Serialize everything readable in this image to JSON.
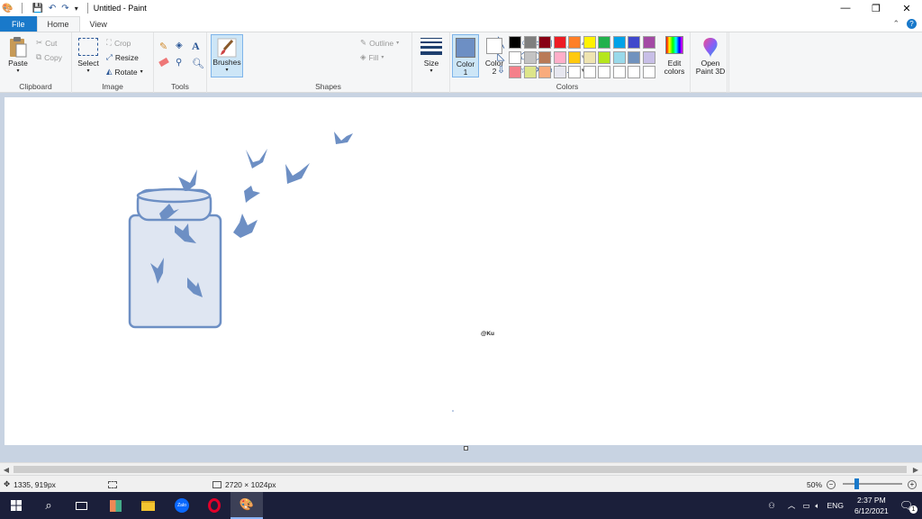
{
  "window": {
    "title": "Untitled - Paint"
  },
  "tabs": {
    "file": "File",
    "home": "Home",
    "view": "View"
  },
  "ribbon": {
    "clipboard": {
      "label": "Clipboard",
      "paste": "Paste",
      "cut": "Cut",
      "copy": "Copy"
    },
    "image": {
      "label": "Image",
      "select": "Select",
      "crop": "Crop",
      "resize": "Resize",
      "rotate": "Rotate"
    },
    "tools": {
      "label": "Tools"
    },
    "brushes": {
      "label": "Brushes"
    },
    "shapes": {
      "label": "Shapes",
      "outline": "Outline",
      "fill": "Fill"
    },
    "size": {
      "label": "Size"
    },
    "colors": {
      "label": "Colors",
      "color1_label": "Color",
      "color1_num": "1",
      "color2_label": "Color",
      "color2_num": "2",
      "color1": "#6d8fc4",
      "color2": "#ffffff",
      "edit": "Edit colors",
      "edit_l1": "Edit",
      "edit_l2": "colors",
      "paint3d_l1": "Open",
      "paint3d_l2": "Paint 3D",
      "palette": [
        "#000000",
        "#7f7f7f",
        "#880015",
        "#ed1c24",
        "#ff7f27",
        "#fff200",
        "#22b14c",
        "#00a2e8",
        "#3f48cc",
        "#a349a4",
        "#ffffff",
        "#c3c3c3",
        "#b97a57",
        "#ffaec9",
        "#ffc90e",
        "#efe4b0",
        "#b5e61d",
        "#99d9ea",
        "#7092be",
        "#c8bfe7",
        "#f5808a",
        "#dde58a",
        "#f9ab7c",
        "#e7e7f0",
        "#ffffff",
        "#ffffff",
        "#ffffff",
        "#ffffff",
        "#ffffff",
        "#ffffff"
      ]
    }
  },
  "canvas": {
    "watermark": "@Ku"
  },
  "status": {
    "cursor_pos": "1335, 919px",
    "image_size": "2720 × 1024px",
    "zoom": "50%"
  },
  "taskbar": {
    "lang": "ENG",
    "time": "2:37 PM",
    "date": "6/12/2021",
    "notifications": "1"
  }
}
